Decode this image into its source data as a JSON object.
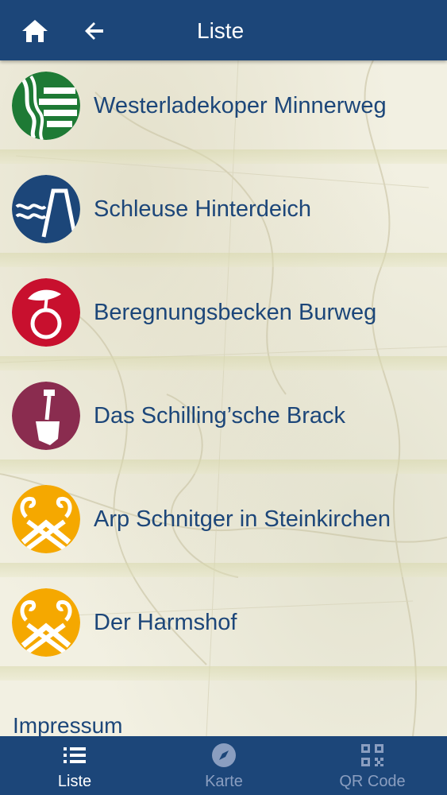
{
  "app_bar": {
    "title": "Liste",
    "home_icon": "home-icon",
    "back_icon": "arrow-back-icon",
    "color": "#1c4679"
  },
  "items": [
    {
      "label": "Westerladekoper Minnerweg",
      "icon": "dike-path-icon",
      "color": "#1e7a35"
    },
    {
      "label": "Schleuse Hinterdeich",
      "icon": "sluice-icon",
      "color": "#1c4679"
    },
    {
      "label": "Beregnungsbecken  Burweg",
      "icon": "cherry-icon",
      "color": "#c8102e"
    },
    {
      "label": "Das Schilling’sche Brack",
      "icon": "spade-icon",
      "color": "#8a2c4f"
    },
    {
      "label": "Arp Schnitger in Steinkirchen",
      "icon": "swan-gable-icon",
      "color": "#f5a800"
    },
    {
      "label": "Der Harmshof",
      "icon": "swan-gable-icon",
      "color": "#f5a800"
    }
  ],
  "footer_link": "Impressum",
  "bottom_nav": [
    {
      "label": "Liste",
      "icon": "list-icon",
      "active": true
    },
    {
      "label": "Karte",
      "icon": "compass-icon",
      "active": false
    },
    {
      "label": "QR Code",
      "icon": "qr-code-icon",
      "active": false
    }
  ]
}
